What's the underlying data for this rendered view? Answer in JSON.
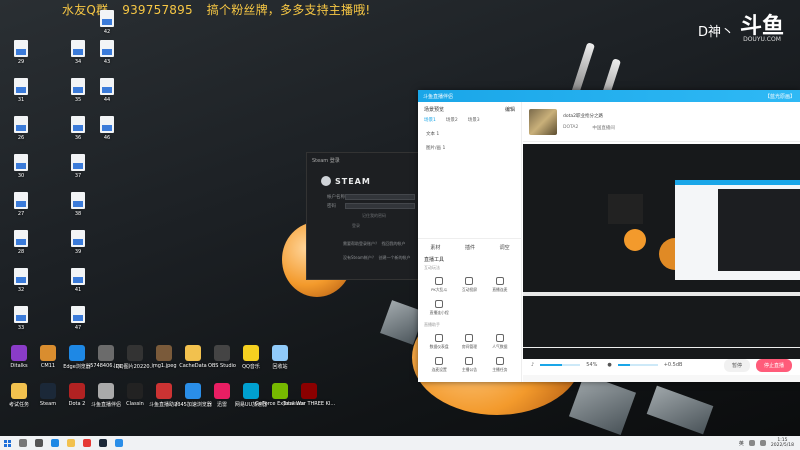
{
  "overlay": {
    "text1": "水友Q群",
    "text2": "939757895",
    "text3": "搞个粉丝牌，多多支持主播哦!"
  },
  "watermark": {
    "name": "D神丶",
    "logo": "斗鱼",
    "domain": "DOUYU.COM"
  },
  "desktop_files": [
    {
      "label": "29"
    },
    {
      "label": "34"
    },
    {
      "label": "43"
    },
    {
      "label": "42"
    },
    {
      "label": "31"
    },
    {
      "label": "35"
    },
    {
      "label": "44"
    },
    {
      "label": "26"
    },
    {
      "label": "36"
    },
    {
      "label": "46"
    },
    {
      "label": "30"
    },
    {
      "label": "37"
    },
    {
      "label": "27"
    },
    {
      "label": "38"
    },
    {
      "label": "28"
    },
    {
      "label": "39"
    },
    {
      "label": "32"
    },
    {
      "label": "41"
    },
    {
      "label": "33"
    },
    {
      "label": "47"
    }
  ],
  "desktop_apps_row1": [
    {
      "label": "Ditalks",
      "color": "#8a3cc8"
    },
    {
      "label": "CM11",
      "color": "#d98d2f"
    },
    {
      "label": "Edge浏览器",
      "color": "#1e88e5"
    },
    {
      "label": "5748406.jpg",
      "color": "#6b6b6b"
    },
    {
      "label": "QQ图片20220...",
      "color": "#333333"
    },
    {
      "label": "img1.jpeg",
      "color": "#7a5a3a"
    },
    {
      "label": "CacheData",
      "color": "#f2c14e"
    },
    {
      "label": "OBS Studio",
      "color": "#444444"
    },
    {
      "label": "QQ音乐",
      "color": "#f5d020"
    },
    {
      "label": "回收站",
      "color": "#90caf9"
    }
  ],
  "desktop_apps_row2": [
    {
      "label": "考试任务",
      "color": "#f2c14e"
    },
    {
      "label": "Steam",
      "color": "#1b2838"
    },
    {
      "label": "Dota 2",
      "color": "#b22222"
    },
    {
      "label": "斗鱼直播伴侣",
      "color": "#aaaaaa"
    },
    {
      "label": "Classin",
      "color": "#222222"
    },
    {
      "label": "斗鱼直播助手",
      "color": "#cc3333"
    },
    {
      "label": "2345加速浏览器",
      "color": "#2a8ee8"
    },
    {
      "label": "迅雷",
      "color": "#e91e63"
    },
    {
      "label": "网易UU加速器",
      "color": "#00a0d0"
    },
    {
      "label": "GeForce Experience",
      "color": "#76b900"
    },
    {
      "label": "Total War THREE KI...",
      "color": "#8b0000"
    }
  ],
  "steam": {
    "title": "Steam 登录",
    "brand": "STEAM",
    "account_label": "帐户名称",
    "account_value": "",
    "password_label": "密码",
    "password_value": "",
    "remember": "记住我的密码",
    "login": "登录",
    "need_help": "需要帮助登录账户？",
    "need_help_link": "找回我的帐户",
    "no_account": "没有Steam帐户？",
    "create_link": "创建一个新的帐户"
  },
  "live": {
    "title": "斗鱼直播伴侣",
    "title_right": "【蓝光原画】",
    "scene_title": "场景预览",
    "scene_edit": "编辑",
    "scene_tabs": [
      "场景1",
      "场景2",
      "场景3"
    ],
    "sources": [
      "文本 1",
      "图片/画 1"
    ],
    "tools": [
      "素材",
      "插件",
      "调空"
    ],
    "section": "直播工具",
    "subsection": "互动玩法",
    "grid1": [
      "PK大乱斗",
      "互动投屏",
      "直播连麦",
      "直播连小程"
    ],
    "subsection2": "直播助手",
    "grid2": [
      "数据仪表盘",
      "房间管理",
      "人气数据",
      "连麦设置",
      "主播公告",
      "主播任务"
    ],
    "room_title": "dota2职业抢分之路",
    "room_game": "DOTA2",
    "room_type": "中国直播间",
    "volume_value": "54%",
    "mic_value": "+0.5dB",
    "pause": "暂停",
    "stop": "停止直播"
  },
  "taskbar": {
    "time": "1:15",
    "date": "2022/5/18",
    "ime": "英"
  }
}
